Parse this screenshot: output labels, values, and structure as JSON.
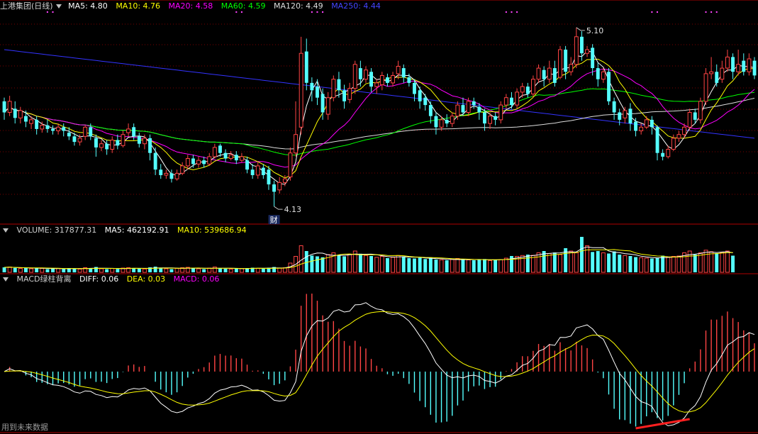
{
  "colors": {
    "up": "#ff4444",
    "down": "#54ffff",
    "ma5": "#ffffff",
    "ma10": "#ffff00",
    "ma20": "#ff00ff",
    "ma60": "#00ff00",
    "ma120": "#dddddd",
    "ma250": "#3333ff",
    "grid": "#7a0000",
    "divider": "#b00000",
    "highlight": "#ff2020"
  },
  "header_main": {
    "title": "上港集团(日线)",
    "ma5": "MA5: 4.80",
    "ma10": "MA10: 4.76",
    "ma20": "MA20: 4.58",
    "ma60": "MA60: 4.59",
    "ma120": "MA120: 4.49",
    "ma250": "MA250: 4.44"
  },
  "header_volume": {
    "volume": "VOLUME: 317877.31",
    "ma5": "MA5: 462192.91",
    "ma10": "MA10: 539686.94"
  },
  "header_macd": {
    "title": "MACD绿柱背离",
    "diff": "DIFF: 0.06",
    "dea": "DEA: 0.03",
    "macd": "MACD: 0.06"
  },
  "footer": "用到未来数据",
  "chart_data": {
    "type": "candlestick",
    "price_range": [
      4.05,
      5.18
    ],
    "annotations": {
      "high_label": "5.10",
      "low_label": "4.13",
      "event_label": "财"
    },
    "candles": [
      [
        4.7,
        4.64,
        4.72,
        4.6
      ],
      [
        4.64,
        4.7,
        4.73,
        4.62
      ],
      [
        4.66,
        4.61,
        4.7,
        4.58
      ],
      [
        4.61,
        4.65,
        4.67,
        4.58
      ],
      [
        4.62,
        4.59,
        4.65,
        4.56
      ],
      [
        4.58,
        4.6,
        4.62,
        4.55
      ],
      [
        4.6,
        4.55,
        4.62,
        4.52
      ],
      [
        4.55,
        4.57,
        4.59,
        4.53
      ],
      [
        4.57,
        4.55,
        4.6,
        4.53
      ],
      [
        4.55,
        4.54,
        4.57,
        4.52
      ],
      [
        4.54,
        4.56,
        4.58,
        4.52
      ],
      [
        4.56,
        4.54,
        4.58,
        4.51
      ],
      [
        4.53,
        4.51,
        4.56,
        4.49
      ],
      [
        4.51,
        4.48,
        4.53,
        4.46
      ],
      [
        4.48,
        4.5,
        4.52,
        4.46
      ],
      [
        4.51,
        4.56,
        4.57,
        4.49
      ],
      [
        4.56,
        4.51,
        4.58,
        4.49
      ],
      [
        4.5,
        4.45,
        4.52,
        4.4
      ],
      [
        4.45,
        4.47,
        4.49,
        4.43
      ],
      [
        4.47,
        4.44,
        4.49,
        4.41
      ],
      [
        4.44,
        4.49,
        4.51,
        4.42
      ],
      [
        4.49,
        4.46,
        4.52,
        4.44
      ],
      [
        4.46,
        4.52,
        4.54,
        4.45
      ],
      [
        4.53,
        4.55,
        4.58,
        4.51
      ],
      [
        4.56,
        4.51,
        4.58,
        4.49
      ],
      [
        4.51,
        4.47,
        4.53,
        4.45
      ],
      [
        4.47,
        4.5,
        4.52,
        4.44
      ],
      [
        4.5,
        4.42,
        4.52,
        4.38
      ],
      [
        4.42,
        4.33,
        4.45,
        4.3
      ],
      [
        4.33,
        4.3,
        4.36,
        4.28
      ],
      [
        4.3,
        4.31,
        4.33,
        4.28
      ],
      [
        4.31,
        4.28,
        4.33,
        4.26
      ],
      [
        4.28,
        4.31,
        4.33,
        4.27
      ],
      [
        4.31,
        4.35,
        4.37,
        4.3
      ],
      [
        4.35,
        4.39,
        4.41,
        4.33
      ],
      [
        4.39,
        4.36,
        4.41,
        4.34
      ],
      [
        4.36,
        4.38,
        4.4,
        4.34
      ],
      [
        4.38,
        4.36,
        4.4,
        4.34
      ],
      [
        4.36,
        4.4,
        4.42,
        4.35
      ],
      [
        4.4,
        4.45,
        4.47,
        4.39
      ],
      [
        4.46,
        4.42,
        4.47,
        4.4
      ],
      [
        4.42,
        4.39,
        4.44,
        4.37
      ],
      [
        4.39,
        4.41,
        4.43,
        4.38
      ],
      [
        4.41,
        4.38,
        4.43,
        4.36
      ],
      [
        4.38,
        4.4,
        4.42,
        4.37
      ],
      [
        4.38,
        4.33,
        4.4,
        4.31
      ],
      [
        4.33,
        4.3,
        4.36,
        4.28
      ],
      [
        4.3,
        4.35,
        4.37,
        4.28
      ],
      [
        4.34,
        4.3,
        4.36,
        4.28
      ],
      [
        4.33,
        4.25,
        4.35,
        4.22
      ],
      [
        4.25,
        4.21,
        4.27,
        4.13
      ],
      [
        4.22,
        4.26,
        4.29,
        4.2
      ],
      [
        4.26,
        4.28,
        4.3,
        4.24
      ],
      [
        4.29,
        4.42,
        4.45,
        4.27
      ],
      [
        4.42,
        4.52,
        4.7,
        4.4
      ],
      [
        4.56,
        4.96,
        5.05,
        4.52
      ],
      [
        4.97,
        4.8,
        5.04,
        4.76
      ],
      [
        4.8,
        4.76,
        4.83,
        4.7
      ],
      [
        4.78,
        4.72,
        4.82,
        4.68
      ],
      [
        4.74,
        4.64,
        4.77,
        4.6
      ],
      [
        4.63,
        4.72,
        4.75,
        4.6
      ],
      [
        4.72,
        4.82,
        4.84,
        4.7
      ],
      [
        4.82,
        4.76,
        4.86,
        4.72
      ],
      [
        4.76,
        4.7,
        4.79,
        4.66
      ],
      [
        4.71,
        4.77,
        4.8,
        4.69
      ],
      [
        4.77,
        4.9,
        4.92,
        4.74
      ],
      [
        4.88,
        4.82,
        4.92,
        4.78
      ],
      [
        4.82,
        4.87,
        4.89,
        4.8
      ],
      [
        4.86,
        4.78,
        4.88,
        4.75
      ],
      [
        4.78,
        4.8,
        4.82,
        4.74
      ],
      [
        4.79,
        4.84,
        4.86,
        4.76
      ],
      [
        4.83,
        4.8,
        4.85,
        4.78
      ],
      [
        4.8,
        4.84,
        4.86,
        4.78
      ],
      [
        4.85,
        4.89,
        4.92,
        4.82
      ],
      [
        4.88,
        4.83,
        4.9,
        4.8
      ],
      [
        4.83,
        4.8,
        4.85,
        4.78
      ],
      [
        4.8,
        4.74,
        4.82,
        4.7
      ],
      [
        4.76,
        4.7,
        4.78,
        4.66
      ],
      [
        4.72,
        4.68,
        4.74,
        4.65
      ],
      [
        4.68,
        4.62,
        4.7,
        4.58
      ],
      [
        4.62,
        4.56,
        4.64,
        4.52
      ],
      [
        4.56,
        4.6,
        4.62,
        4.54
      ],
      [
        4.6,
        4.58,
        4.63,
        4.56
      ],
      [
        4.58,
        4.62,
        4.64,
        4.56
      ],
      [
        4.62,
        4.68,
        4.7,
        4.6
      ],
      [
        4.68,
        4.64,
        4.72,
        4.62
      ],
      [
        4.64,
        4.7,
        4.72,
        4.62
      ],
      [
        4.7,
        4.68,
        4.72,
        4.66
      ],
      [
        4.67,
        4.64,
        4.69,
        4.6
      ],
      [
        4.64,
        4.58,
        4.66,
        4.54
      ],
      [
        4.58,
        4.62,
        4.64,
        4.55
      ],
      [
        4.62,
        4.6,
        4.64,
        4.57
      ],
      [
        4.6,
        4.68,
        4.7,
        4.58
      ],
      [
        4.68,
        4.72,
        4.74,
        4.66
      ],
      [
        4.72,
        4.68,
        4.75,
        4.66
      ],
      [
        4.68,
        4.75,
        4.77,
        4.66
      ],
      [
        4.75,
        4.78,
        4.8,
        4.72
      ],
      [
        4.78,
        4.74,
        4.8,
        4.72
      ],
      [
        4.74,
        4.82,
        4.84,
        4.72
      ],
      [
        4.82,
        4.88,
        4.9,
        4.8
      ],
      [
        4.87,
        4.82,
        4.89,
        4.78
      ],
      [
        4.82,
        4.88,
        4.92,
        4.8
      ],
      [
        4.88,
        4.8,
        4.92,
        4.78
      ],
      [
        4.83,
        4.98,
        5.0,
        4.82
      ],
      [
        4.98,
        4.86,
        5.0,
        4.82
      ],
      [
        4.86,
        4.9,
        4.94,
        4.84
      ],
      [
        4.9,
        5.05,
        5.1,
        4.88
      ],
      [
        5.05,
        4.96,
        5.08,
        4.92
      ],
      [
        4.96,
        4.98,
        5.0,
        4.94
      ],
      [
        4.99,
        4.88,
        5.01,
        4.84
      ],
      [
        4.88,
        4.82,
        4.91,
        4.78
      ],
      [
        4.82,
        4.86,
        4.88,
        4.8
      ],
      [
        4.86,
        4.7,
        4.88,
        4.68
      ],
      [
        4.7,
        4.64,
        4.72,
        4.6
      ],
      [
        4.64,
        4.6,
        4.66,
        4.57
      ],
      [
        4.61,
        4.65,
        4.67,
        4.58
      ],
      [
        4.66,
        4.58,
        4.69,
        4.54
      ],
      [
        4.59,
        4.54,
        4.61,
        4.51
      ],
      [
        4.54,
        4.56,
        4.58,
        4.52
      ],
      [
        4.56,
        4.6,
        4.62,
        4.55
      ],
      [
        4.6,
        4.56,
        4.62,
        4.52
      ],
      [
        4.56,
        4.42,
        4.57,
        4.38
      ],
      [
        4.42,
        4.4,
        4.44,
        4.38
      ],
      [
        4.4,
        4.44,
        4.46,
        4.39
      ],
      [
        4.44,
        4.5,
        4.52,
        4.43
      ],
      [
        4.5,
        4.52,
        4.54,
        4.48
      ],
      [
        4.52,
        4.56,
        4.58,
        4.5
      ],
      [
        4.56,
        4.64,
        4.66,
        4.54
      ],
      [
        4.64,
        4.6,
        4.66,
        4.58
      ],
      [
        4.6,
        4.7,
        4.72,
        4.58
      ],
      [
        4.7,
        4.85,
        4.88,
        4.68
      ],
      [
        4.85,
        4.86,
        4.94,
        4.82
      ],
      [
        4.86,
        4.8,
        4.9,
        4.78
      ],
      [
        4.82,
        4.88,
        4.92,
        4.8
      ],
      [
        4.88,
        4.94,
        4.98,
        4.86
      ],
      [
        4.94,
        4.86,
        4.96,
        4.82
      ],
      [
        4.86,
        4.9,
        4.98,
        4.84
      ],
      [
        4.92,
        4.86,
        4.96,
        4.84
      ],
      [
        4.86,
        4.93,
        4.96,
        4.84
      ],
      [
        4.92,
        4.84,
        4.94,
        4.82
      ]
    ],
    "volume": [
      28,
      30,
      25,
      22,
      24,
      20,
      26,
      22,
      18,
      20,
      22,
      19,
      24,
      21,
      18,
      26,
      22,
      30,
      20,
      18,
      22,
      19,
      24,
      26,
      22,
      20,
      19,
      28,
      32,
      26,
      20,
      18,
      22,
      26,
      28,
      22,
      20,
      18,
      24,
      30,
      22,
      20,
      18,
      20,
      22,
      24,
      26,
      22,
      20,
      26,
      30,
      24,
      26,
      52,
      90,
      150,
      120,
      95,
      90,
      85,
      100,
      110,
      95,
      90,
      100,
      120,
      105,
      95,
      92,
      85,
      90,
      80,
      85,
      95,
      90,
      80,
      78,
      82,
      75,
      82,
      72,
      70,
      68,
      72,
      78,
      72,
      70,
      68,
      72,
      75,
      66,
      70,
      72,
      80,
      92,
      90,
      95,
      100,
      96,
      110,
      120,
      106,
      112,
      100,
      136,
      120,
      110,
      200,
      150,
      115,
      120,
      110,
      106,
      118,
      100,
      95,
      92,
      86,
      82,
      80,
      78,
      82,
      94,
      86,
      90,
      92,
      110,
      120,
      100,
      110,
      125,
      116,
      108,
      112,
      120,
      94
    ]
  }
}
